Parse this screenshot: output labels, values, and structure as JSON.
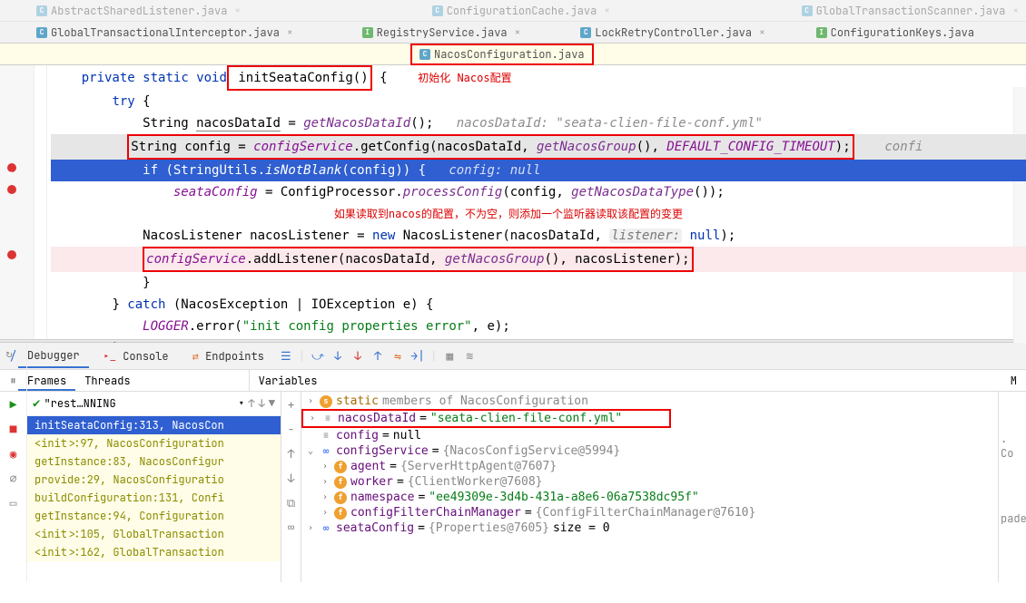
{
  "tabs_row1": [
    {
      "name": "AbstractSharedListener.java",
      "icon": "c"
    },
    {
      "name": "ConfigurationCache.java",
      "icon": "c"
    },
    {
      "name": "GlobalTransactionScanner.java",
      "icon": "c"
    }
  ],
  "tabs_row2": [
    {
      "name": "GlobalTransactionalInterceptor.java",
      "icon": "c"
    },
    {
      "name": "RegistryService.java",
      "icon": "i"
    },
    {
      "name": "LockRetryController.java",
      "icon": "c"
    },
    {
      "name": "ConfigurationKeys.java",
      "icon": "i"
    }
  ],
  "tabs_row3": [
    {
      "name": "NacosConfiguration.java",
      "icon": "c"
    }
  ],
  "code": {
    "l1_a": "private",
    "l1_b": "static",
    "l1_c": "void",
    "l1_method": "initSeataConfig",
    "l1_paren": "()",
    "l1_brace": " {",
    "l1_ann": "初始化 Nacos配置",
    "l2": "try",
    "l2b": " {",
    "l3_a": "String ",
    "l3_b": "nacosDataId",
    "l3_c": " = ",
    "l3_d": "getNacosDataId",
    "l3_e": "();",
    "l3_hint": "nacosDataId: \"seata-clien-file-conf.yml\"",
    "l4_a": "String config = ",
    "l4_b": "configService",
    "l4_c": ".getConfig(",
    "l4_d": "nacosDataId",
    "l4_e": ", ",
    "l4_f": "getNacosGroup",
    "l4_g": "(), ",
    "l4_h": "DEFAULT_CONFIG_TIMEOUT",
    "l4_i": ");",
    "l4_tail": "  confi",
    "l5_a": "if",
    "l5_b": " (StringUtils.",
    "l5_c": "isNotBlank",
    "l5_d": "(config)) {",
    "l5_hint": "config: null",
    "l6_a": "seataConfig",
    "l6_b": " = ConfigProcessor.",
    "l6_c": "processConfig",
    "l6_d": "(config, ",
    "l6_e": "getNacosDataType",
    "l6_f": "());",
    "l6_ann": "如果读取到nacos的配置，不为空，则添加一个监听器读取该配置的变更",
    "l7_a": "NacosListener nacosListener = ",
    "l7_b": "new",
    "l7_c": " NacosListener(",
    "l7_d": "nacosDataId",
    "l7_e": ", ",
    "l7_hint": "listener:",
    "l7_null": " null",
    "l7_f": ");",
    "l8_a": "configService",
    "l8_b": ".addListener(",
    "l8_c": "nacosDataId",
    "l8_d": ", ",
    "l8_e": "getNacosGroup",
    "l8_f": "(), nacosListener);",
    "l9": "}",
    "l10_a": "} ",
    "l10_b": "catch",
    "l10_c": " (NacosException | IOException e) {",
    "l11_a": "LOGGER",
    "l11_b": ".error(",
    "l11_c": "\"init config properties error\"",
    "l11_d": ", e);",
    "l12": "}"
  },
  "debugger": {
    "tab_debugger": "Debugger",
    "tab_console": "Console",
    "tab_endpoints": "Endpoints",
    "col_frames": "Frames",
    "col_threads": "Threads",
    "col_variables": "Variables",
    "col_m": "M",
    "thread": "\"rest…NNING",
    "frames": [
      "initSeataConfig:313, NacosCon",
      "<init>:97, NacosConfiguration",
      "getInstance:83, NacosConfigur",
      "provide:29, NacosConfiguratio",
      "buildConfiguration:131, Confi",
      "getInstance:94, Configuration",
      "<init>:105, GlobalTransaction",
      "<init>:162, GlobalTransaction"
    ],
    "vars": {
      "static": "static",
      "static_suf": "members of NacosConfiguration",
      "ndid_name": "nacosDataId",
      "ndid_val": "\"seata-clien-file-conf.yml\"",
      "config_name": "config",
      "config_val": "null",
      "cs_name": "configService",
      "cs_val": "{NacosConfigService@5994}",
      "agent_name": "agent",
      "agent_val": "{ServerHttpAgent@7607}",
      "worker_name": "worker",
      "worker_val": "{ClientWorker@7608}",
      "ns_name": "namespace",
      "ns_val": "\"ee49309e-3d4b-431a-a8e6-06a7538dc95f\"",
      "cfm_name": "configFilterChainManager",
      "cfm_val": "{ConfigFilterChainManager@7610}",
      "sc_name": "seataConfig",
      "sc_val": "{Properties@7605}",
      "sc_size": "size = 0"
    },
    "right_snip1": ". Co",
    "right_snip2": "paded."
  }
}
